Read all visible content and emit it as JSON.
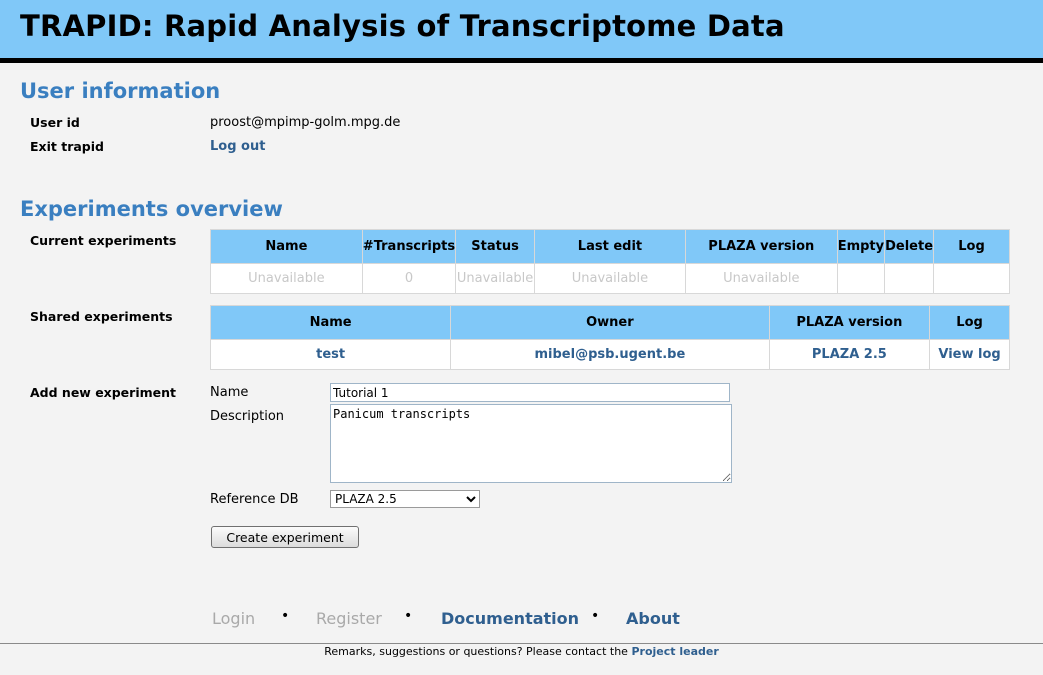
{
  "header": {
    "title": "TRAPID: Rapid Analysis of Transcriptome Data"
  },
  "user_info": {
    "title": "User information",
    "user_id_label": "User id",
    "user_id_value": "proost@mpimp-golm.mpg.de",
    "exit_label": "Exit trapid",
    "logout_link": "Log out"
  },
  "experiments": {
    "title": "Experiments overview",
    "current_label": "Current experiments",
    "current_table": {
      "columns": [
        "Name",
        "#Transcripts",
        "Status",
        "Last edit",
        "PLAZA version",
        "Empty",
        "Delete",
        "Log"
      ],
      "rows": [
        [
          "Unavailable",
          "0",
          "Unavailable",
          "Unavailable",
          "Unavailable",
          "",
          "",
          ""
        ]
      ]
    },
    "shared_label": "Shared experiments",
    "shared_table": {
      "columns": [
        "Name",
        "Owner",
        "PLAZA version",
        "Log"
      ],
      "rows": [
        [
          "test",
          "mibel@psb.ugent.be",
          "PLAZA 2.5",
          "View log"
        ]
      ]
    },
    "new_label": "Add new experiment",
    "form": {
      "name_label": "Name",
      "name_value": "Tutorial 1",
      "description_label": "Description",
      "description_value": "Panicum transcripts",
      "refdb_label": "Reference DB",
      "refdb_value": "PLAZA 2.5",
      "submit_label": "Create experiment"
    }
  },
  "footer": {
    "nav": [
      "Login",
      "Register",
      "Documentation",
      "About"
    ],
    "bullet": "•",
    "remark_text": "Remarks, suggestions or questions? Please contact the ",
    "remark_link": "Project leader"
  }
}
